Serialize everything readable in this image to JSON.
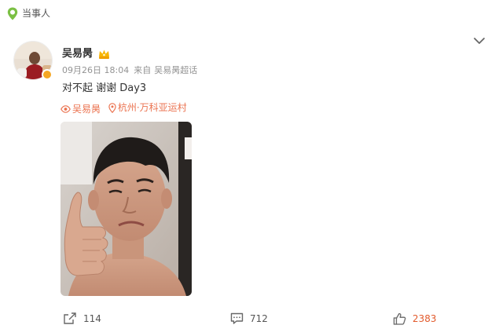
{
  "header": {
    "tag_label": "当事人",
    "tag_icon": "location-pin-icon",
    "tag_color": "#7bc043"
  },
  "post": {
    "author": "吴易昺",
    "timestamp": "09月26日 18:04",
    "source_prefix": "来自",
    "source": "吴易昺超话",
    "text": "对不起 谢谢 Day3",
    "topic_tag": "吴易昺",
    "location_tag": "杭州·万科亚运村",
    "accent_color": "#eb7350"
  },
  "actions": {
    "shares": "114",
    "comments": "712",
    "likes": "2383",
    "like_color": "#e25b2d"
  }
}
